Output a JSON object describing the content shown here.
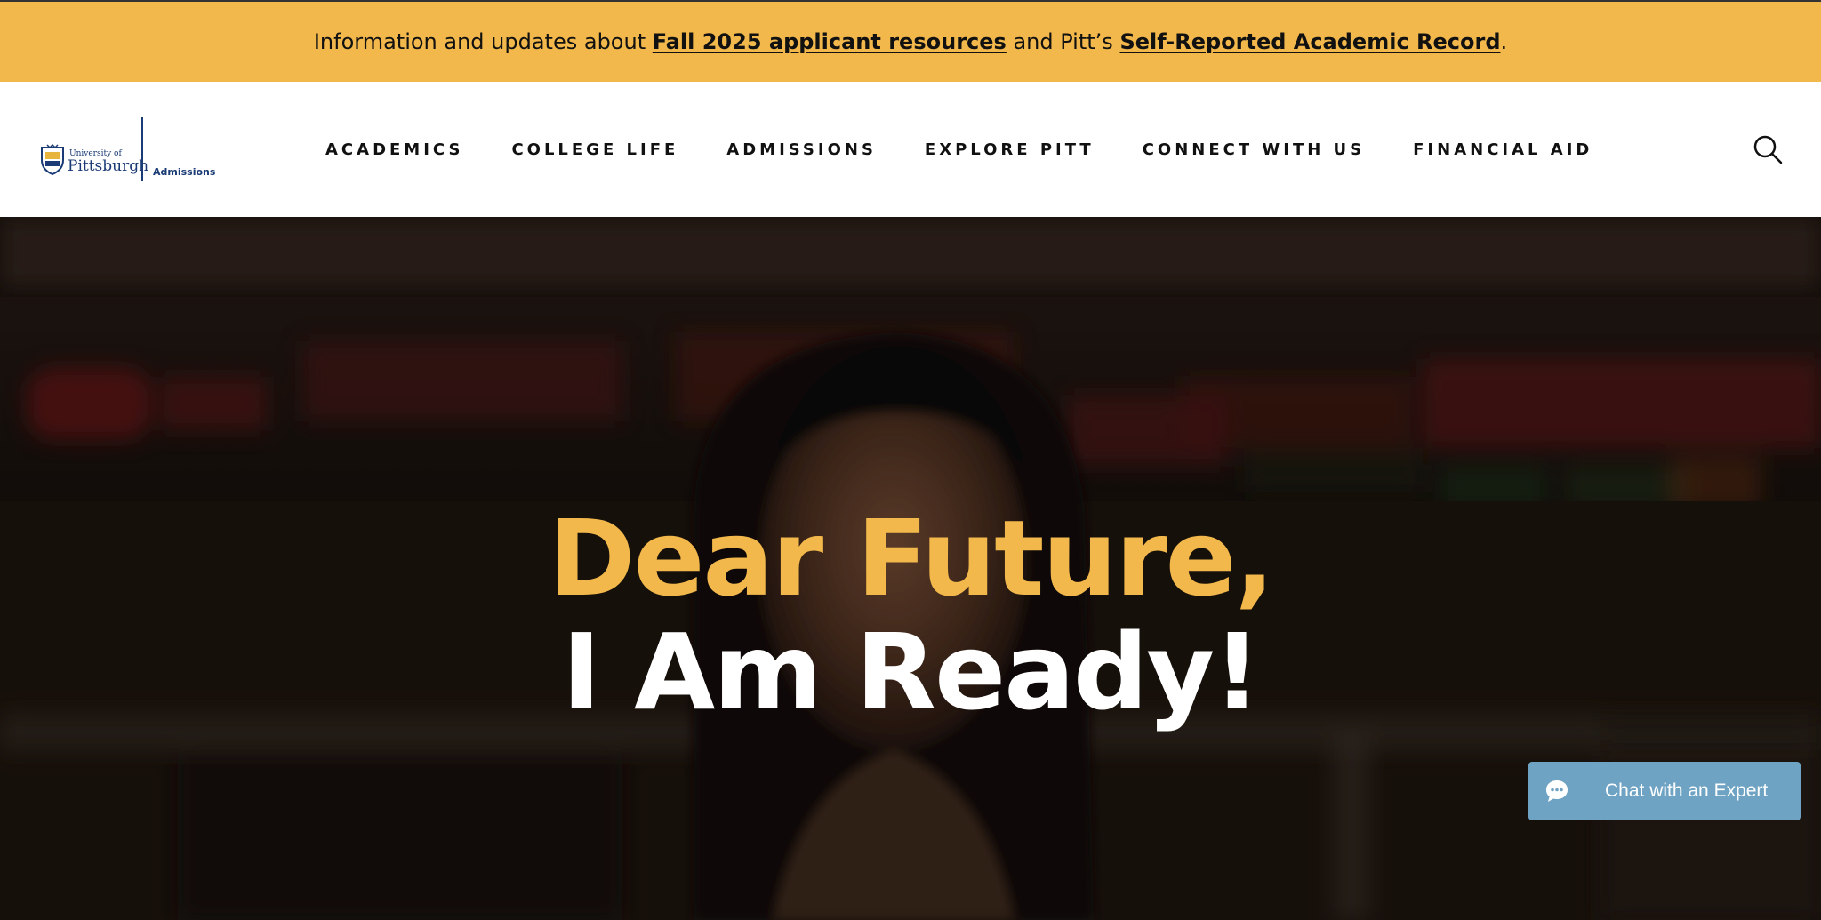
{
  "banner": {
    "prefix": "Information and updates about ",
    "link1": "Fall 2025 applicant resources",
    "middle": " and Pitt’s ",
    "link2": "Self-Reported Academic Record",
    "suffix": ".",
    "background_color": "#f2b84b"
  },
  "logo": {
    "university_line": "University of",
    "name": "Pittsburgh",
    "unit": "Admissions",
    "brand_color": "#1a3b75"
  },
  "nav": {
    "items": [
      {
        "label": "ACADEMICS"
      },
      {
        "label": "COLLEGE LIFE"
      },
      {
        "label": "ADMISSIONS"
      },
      {
        "label": "EXPLORE PITT"
      },
      {
        "label": "CONNECT WITH US"
      },
      {
        "label": "FINANCIAL AID"
      }
    ],
    "search_icon": "search-icon"
  },
  "hero": {
    "line1": "Dear Future,",
    "line2": "I Am Ready!",
    "accent_color": "#f2b84b",
    "background": "video-still-student-portrait"
  },
  "chat": {
    "label": "Chat with an Expert",
    "icon": "chat-bubble-icon",
    "color": "#6fa3c3"
  }
}
